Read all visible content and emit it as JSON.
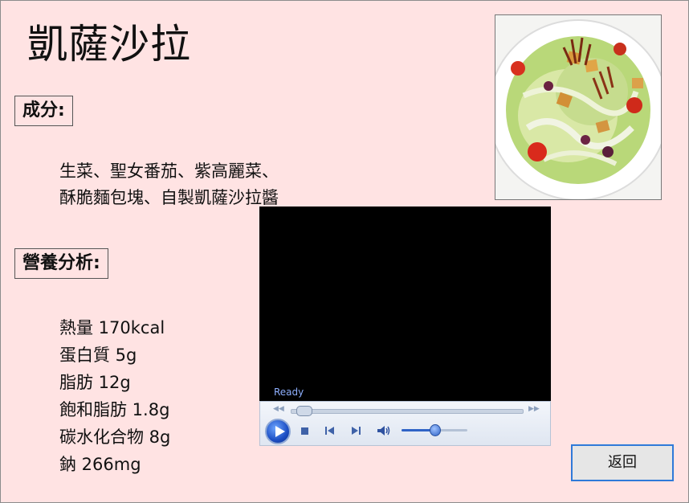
{
  "title": "凱薩沙拉",
  "ingredients": {
    "heading": "成分:",
    "lines": [
      "生菜、聖女番茄、紫高麗菜、",
      "酥脆麵包塊、自製凱薩沙拉醬"
    ]
  },
  "nutrition": {
    "heading": "營養分析:",
    "items": [
      "熱量 170kcal",
      "蛋白質 5g",
      "脂肪 12g",
      "飽和脂肪 1.8g",
      "碳水化合物 8g",
      "鈉 266mg"
    ]
  },
  "photo": {
    "icon": "caesar-salad-photo"
  },
  "media_player": {
    "status": "Ready",
    "seek_progress": 0.03,
    "volume_level": 0.5
  },
  "back_button": {
    "label": "返回"
  },
  "colors": {
    "background": "#ffe3e3",
    "accent": "#2f7ad9"
  }
}
